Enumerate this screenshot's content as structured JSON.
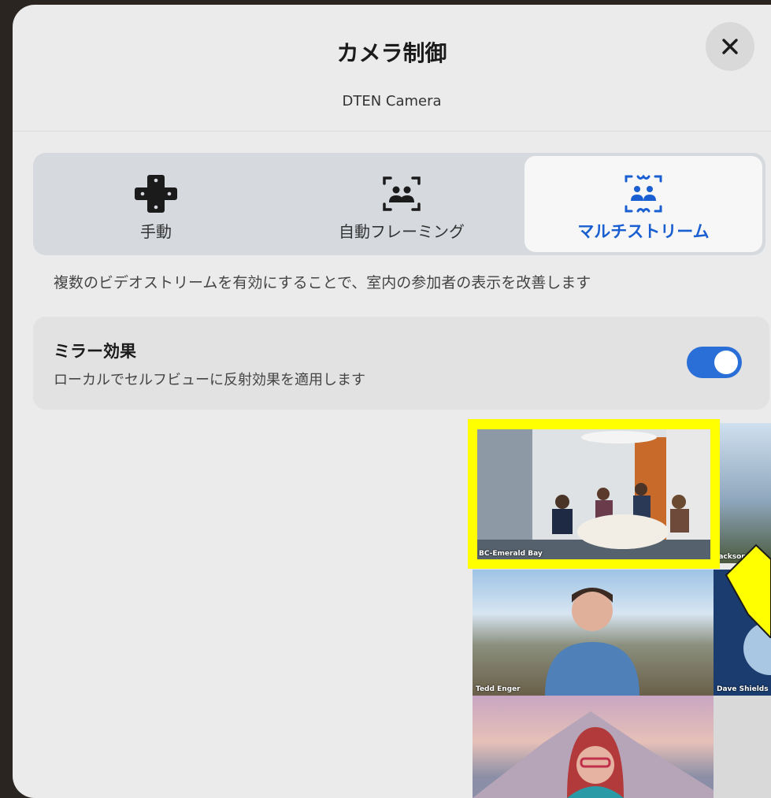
{
  "dialog": {
    "title": "カメラ制御",
    "device": "DTEN Camera",
    "close_icon": "close-icon"
  },
  "modes": [
    {
      "label": "手動",
      "icon": "dpad-icon",
      "selected": false
    },
    {
      "label": "自動フレーミング",
      "icon": "auto-framing-icon",
      "selected": false
    },
    {
      "label": "マルチストリーム",
      "icon": "multistream-icon",
      "selected": true
    }
  ],
  "description": "複数のビデオストリームを有効にすることで、室内の参加者の表示を改善します",
  "mirror": {
    "title": "ミラー効果",
    "subtitle": "ローカルでセルフビューに反射効果を適用します",
    "enabled": true
  },
  "video_tiles": [
    {
      "name": "BC-Emerald Bay",
      "highlighted": true
    },
    {
      "name": "Jackson"
    },
    {
      "name": "Tedd Enger"
    },
    {
      "name": "Dave Shields"
    },
    {
      "name": ""
    }
  ],
  "colors": {
    "accent": "#2a6fd8",
    "highlight": "#ffff00"
  }
}
